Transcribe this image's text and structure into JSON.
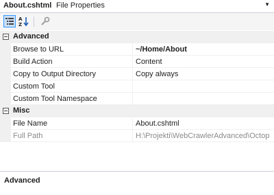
{
  "title": {
    "file_name": "About.cshtml",
    "window_name": "File Properties",
    "dropdown_icon": "chevron-down-icon"
  },
  "toolbar": {
    "buttons": [
      {
        "icon": "categorized-icon",
        "active": true
      },
      {
        "icon": "alphabetical-icon",
        "active": false
      },
      {
        "icon": "property-pages-icon",
        "active": false
      }
    ]
  },
  "categories": {
    "advanced": {
      "label": "Advanced",
      "properties": [
        {
          "name": "Browse to URL",
          "value": "~/Home/About"
        },
        {
          "name": "Build Action",
          "value": "Content"
        },
        {
          "name": "Copy to Output Directory",
          "value": "Copy always"
        },
        {
          "name": "Custom Tool",
          "value": ""
        },
        {
          "name": "Custom Tool Namespace",
          "value": ""
        }
      ]
    },
    "misc": {
      "label": "Misc",
      "properties": [
        {
          "name": "File Name",
          "value": "About.cshtml"
        },
        {
          "name": "Full Path",
          "value": "H:\\Projekti\\WebCrawlerAdvanced\\Octop"
        }
      ]
    }
  },
  "description": {
    "title": "Advanced"
  },
  "colors": {
    "accent": "#3399ff",
    "category_bg": "#f0f0f0",
    "readonly_text": "#8a8a8a"
  }
}
